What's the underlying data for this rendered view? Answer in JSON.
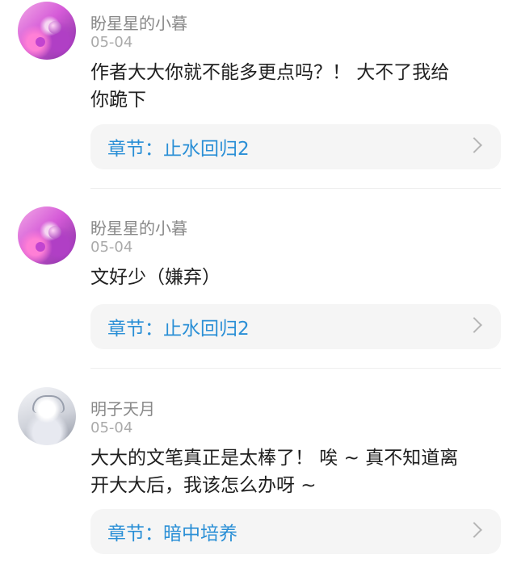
{
  "comments": [
    {
      "username": "盼星星的小暮",
      "date": "05-04",
      "lines": [
        "作者大大你就不能多更点吗？！ 大不了我给",
        "你跪下"
      ],
      "chapter": "章节：止水回归2"
    },
    {
      "username": "盼星星的小暮",
      "date": "05-04",
      "lines": [
        "文好少（嫌弃）"
      ],
      "chapter": "章节：止水回归2"
    },
    {
      "username": "明子天月",
      "date": "05-04",
      "lines": [
        "大大的文笔真正是太棒了！ 唉 ~ 真不知道离",
        "开大大后，我该怎么办呀 ~"
      ],
      "chapter": "章节：暗中培养"
    }
  ],
  "icons": {
    "avatar_1": "avatar-pink-anime",
    "avatar_2": "avatar-pink-anime",
    "avatar_3": "avatar-silver-anime",
    "chevron": "chevron-right-icon"
  },
  "colors": {
    "chapter_link": "#2a8fd6",
    "username": "#888888",
    "date": "#aaaaaa",
    "chapter_bg": "#f5f5f5"
  }
}
